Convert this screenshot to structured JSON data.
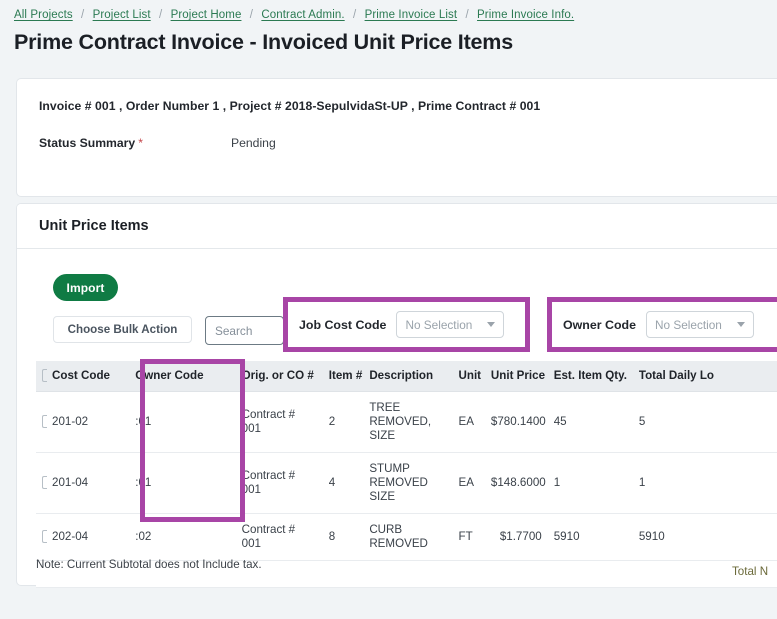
{
  "breadcrumb": {
    "separator": "/",
    "items": [
      {
        "label": "All Projects"
      },
      {
        "label": "Project List"
      },
      {
        "label": "Project Home"
      },
      {
        "label": "Contract Admin."
      },
      {
        "label": "Prime Invoice List"
      },
      {
        "label": "Prime Invoice Info."
      }
    ]
  },
  "page": {
    "title": "Prime Contract Invoice - Invoiced Unit Price Items"
  },
  "summary": {
    "line": "Invoice # 001 , Order Number 1 , Project # 2018-SepulvidaSt-UP , Prime Contract # 001",
    "status_label": "Status Summary",
    "required_marker": "*",
    "status_value": "Pending"
  },
  "items_card": {
    "title": "Unit Price Items"
  },
  "toolbar": {
    "import_label": "Import",
    "bulk_action_label": "Choose Bulk Action",
    "search_placeholder": "Search",
    "search_value": ""
  },
  "filters": [
    {
      "label": "Job Cost Code",
      "value": "No Selection",
      "name": "job-cost-code"
    },
    {
      "label": "Owner Code",
      "value": "No Selection",
      "name": "owner-code"
    }
  ],
  "table": {
    "headers": [
      "Cost Code",
      "Owner Code",
      "Orig. or CO #",
      "Item #",
      "Description",
      "Unit",
      "Unit Price",
      "Est. Item Qty.",
      "Total Daily Lo"
    ],
    "rows": [
      {
        "cost_code": "201-02",
        "owner_code": ":01",
        "orig_or_co": "Contract # 001",
        "item_no": "2",
        "description": "TREE REMOVED, SIZE",
        "unit": "EA",
        "unit_price": "$780.1400",
        "est_item_qty": "45",
        "total_daily": "5"
      },
      {
        "cost_code": "201-04",
        "owner_code": ":01",
        "orig_or_co": "Contract # 001",
        "item_no": "4",
        "description": "STUMP REMOVED SIZE",
        "unit": "EA",
        "unit_price": "$148.6000",
        "est_item_qty": "1",
        "total_daily": "1"
      },
      {
        "cost_code": "202-04",
        "owner_code": ":02",
        "orig_or_co": "Contract # 001",
        "item_no": "8",
        "description": "CURB REMOVED",
        "unit": "FT",
        "unit_price": "$1.7700",
        "est_item_qty": "5910",
        "total_daily": "5910"
      }
    ]
  },
  "footer": {
    "note": "Note: Current Subtotal does not Include tax.",
    "total_label": "Total N"
  },
  "colors": {
    "highlight_purple": "#a845a6",
    "primary_green": "#0f7b44",
    "link_green": "#2b7a52",
    "required_red": "#c4464b",
    "page_background": "#f1f4f6",
    "header_row": "#eaedf0"
  }
}
